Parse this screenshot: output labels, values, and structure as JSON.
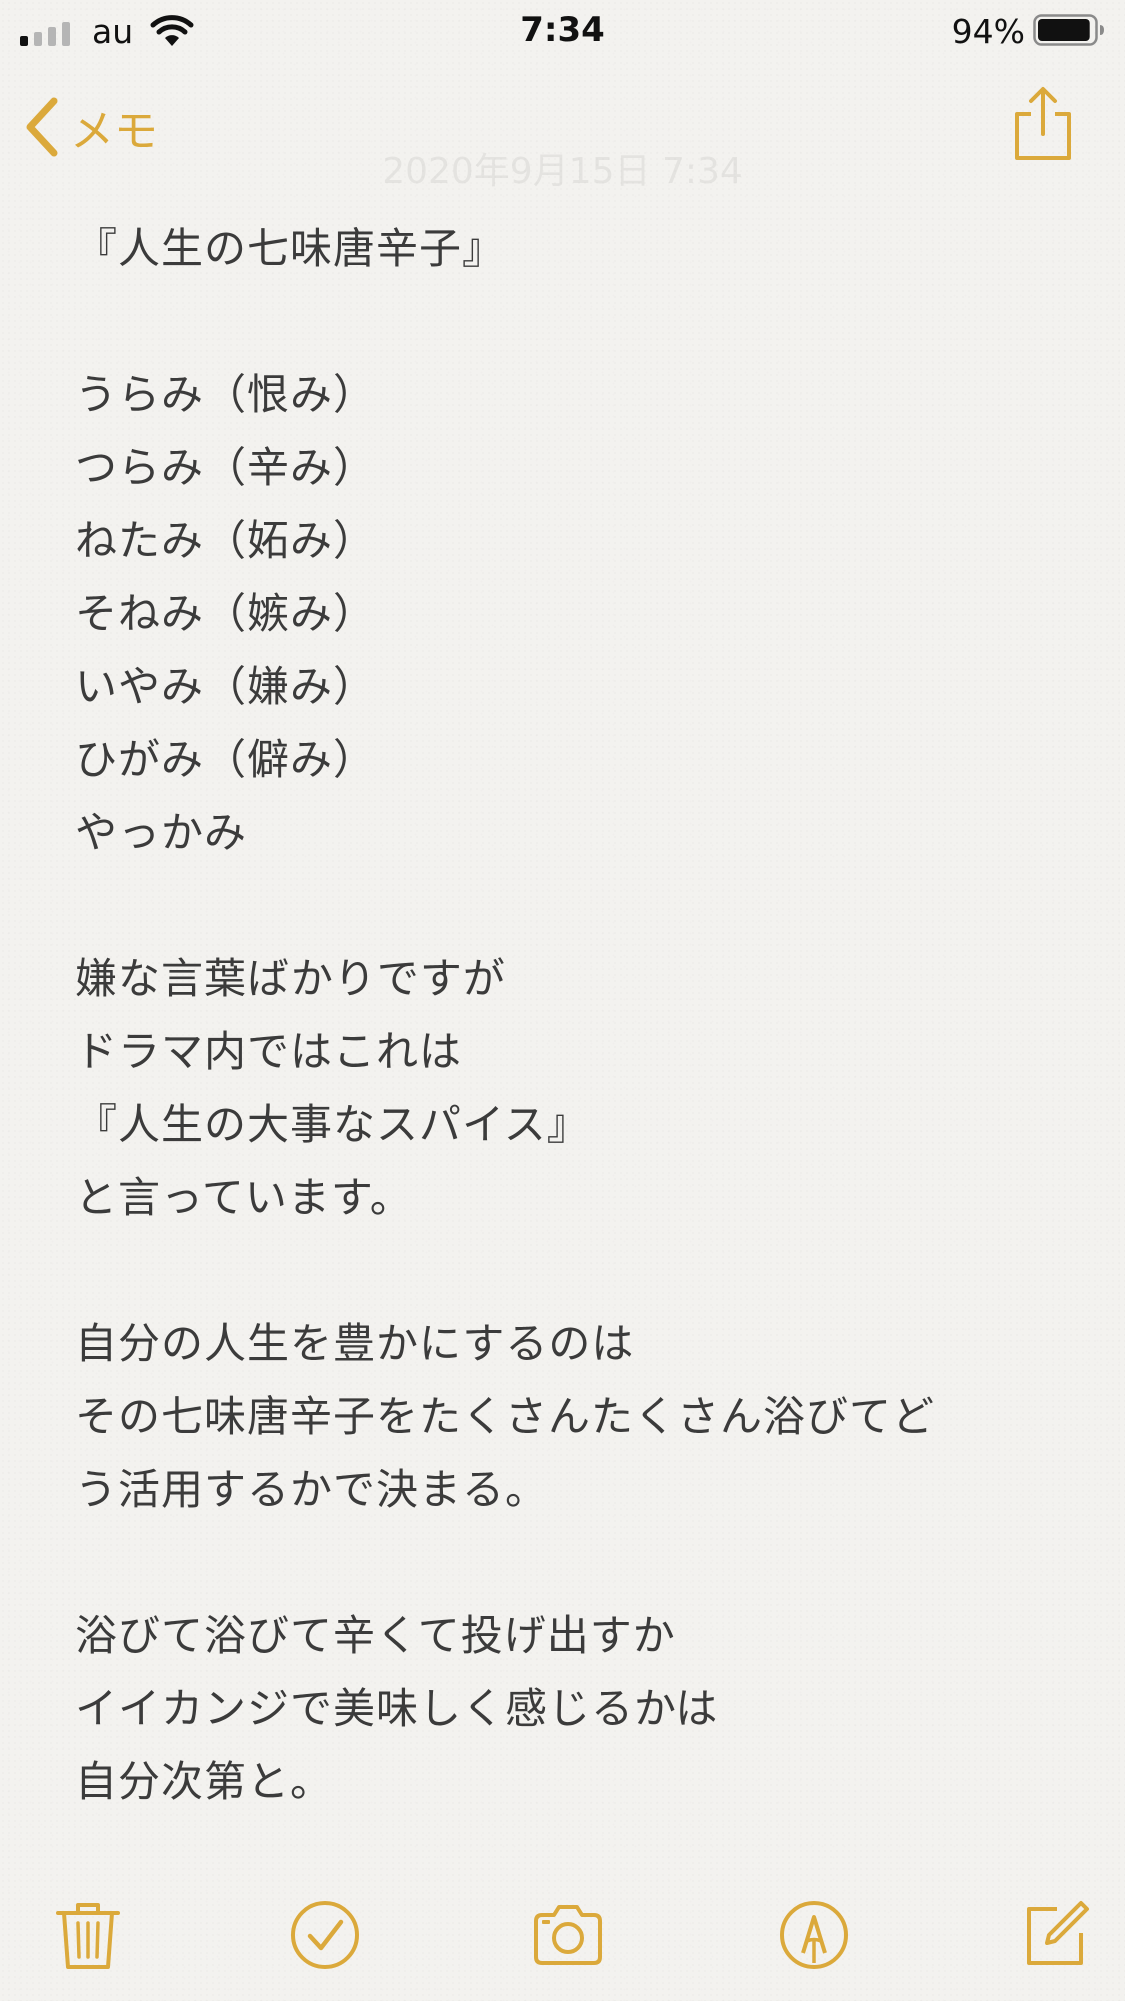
{
  "status_bar": {
    "carrier": "au",
    "time": "7:34",
    "battery_percent": "94%",
    "battery_level": 0.94,
    "signal_bars": 1
  },
  "nav": {
    "back_label": "メモ",
    "timestamp": "2020年9月15日 7:34"
  },
  "note": {
    "lines": [
      "『人生の七味唐辛子』",
      "",
      "うらみ（恨み）",
      "つらみ（辛み）",
      "ねたみ（妬み）",
      "そねみ（嫉み）",
      "いやみ（嫌み）",
      "ひがみ（僻み）",
      "やっかみ",
      "",
      "嫌な言葉ばかりですが",
      "ドラマ内ではこれは",
      "『人生の大事なスパイス』",
      "と言っています。",
      "",
      "自分の人生を豊かにするのは",
      "その七味唐辛子をたくさんたくさん浴びてど",
      "う活用するかで決まる。",
      "",
      "浴びて浴びて辛くて投げ出すか",
      "イイカンジで美味しく感じるかは",
      "自分次第と。"
    ]
  },
  "toolbar": {
    "icons": [
      "trash-icon",
      "checklist-icon",
      "camera-icon",
      "markup-icon",
      "compose-icon"
    ]
  },
  "colors": {
    "accent": "#dba93b",
    "text": "#3b3b3b",
    "background": "#f3f2ef"
  }
}
